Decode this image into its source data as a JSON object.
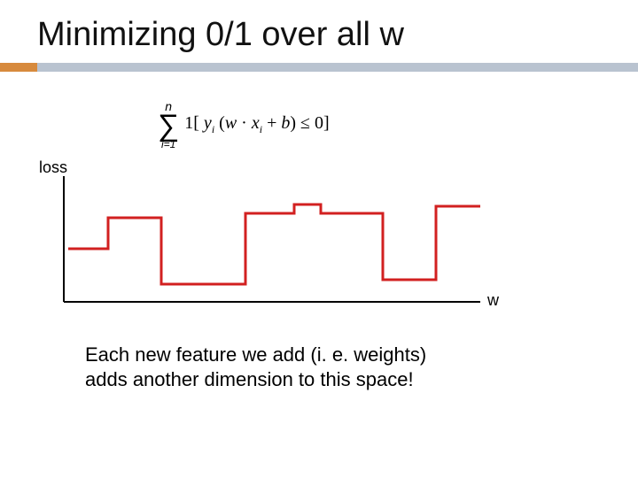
{
  "title": "Minimizing 0/1 over all w",
  "formula": {
    "sum_upper": "n",
    "sum_lower": "i=1",
    "one": "1",
    "lbrack": "[",
    "y": "y",
    "sub_i1": "i",
    "lp": "(",
    "w": "w",
    "dot": "·",
    "x": "x",
    "sub_i2": "i",
    "plus": "+",
    "b": "b",
    "rp": ")",
    "le": "≤",
    "zero": "0",
    "rbrack": "]"
  },
  "chart": {
    "y_label": "loss",
    "x_label": "w"
  },
  "caption_line1": "Each new feature we add (i. e. weights)",
  "caption_line2": "adds another dimension to this space!",
  "chart_data": {
    "type": "line",
    "title": "0/1 loss as a function of w (schematic step function)",
    "xlabel": "w",
    "ylabel": "loss",
    "xlim": [
      0,
      470
    ],
    "ylim": [
      0,
      150
    ],
    "series": [
      {
        "name": "loss",
        "x": [
          5,
          50,
          50,
          110,
          110,
          205,
          205,
          260,
          260,
          290,
          290,
          360,
          360,
          420,
          420,
          470
        ],
        "y": [
          60,
          60,
          95,
          95,
          20,
          20,
          100,
          100,
          110,
          110,
          100,
          100,
          25,
          25,
          108,
          108
        ]
      }
    ]
  }
}
